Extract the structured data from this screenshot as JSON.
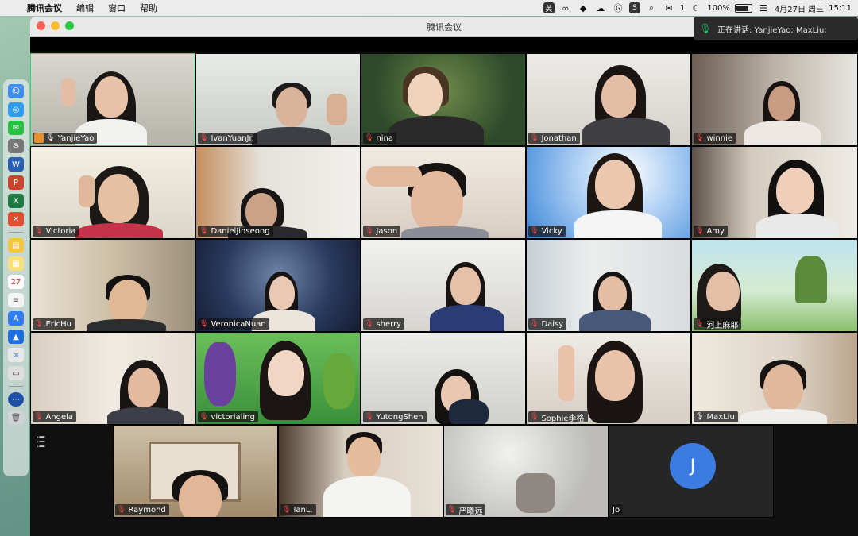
{
  "menubar": {
    "app": "腾讯会议",
    "items": [
      "编辑",
      "窗口",
      "帮助"
    ],
    "status": {
      "input_method": "英",
      "wechat_count": "1",
      "battery": "100%",
      "date": "4月27日 周三",
      "time": "15:11"
    }
  },
  "window": {
    "title": "腾讯会议",
    "speaking_label": "正在讲话: YanjieYao; MaxLiu;"
  },
  "participants": [
    {
      "name": "YanjieYao",
      "mic": "on",
      "host": true,
      "active": true
    },
    {
      "name": "IvanYuanJr.",
      "mic": "muted"
    },
    {
      "name": "nina",
      "mic": "muted"
    },
    {
      "name": "Jonathan",
      "mic": "muted"
    },
    {
      "name": "winnie",
      "mic": "muted"
    },
    {
      "name": "Victoria",
      "mic": "muted"
    },
    {
      "name": "DanielJinseong",
      "mic": "muted"
    },
    {
      "name": "Jason",
      "mic": "muted"
    },
    {
      "name": "Vicky",
      "mic": "muted"
    },
    {
      "name": "Amy",
      "mic": "muted"
    },
    {
      "name": "EricHu",
      "mic": "muted"
    },
    {
      "name": "VeronicaNuan",
      "mic": "muted"
    },
    {
      "name": "sherry",
      "mic": "muted"
    },
    {
      "name": "Daisy",
      "mic": "muted"
    },
    {
      "name": "河上麻耶",
      "mic": "muted"
    },
    {
      "name": "Angela",
      "mic": "muted"
    },
    {
      "name": "victorialing",
      "mic": "muted"
    },
    {
      "name": "YutongShen",
      "mic": "muted"
    },
    {
      "name": "Sophie李格",
      "mic": "muted"
    },
    {
      "name": "MaxLiu",
      "mic": "on"
    },
    {
      "name": "Raymond",
      "mic": "muted"
    },
    {
      "name": "IanL.",
      "mic": "muted"
    },
    {
      "name": "严曦远",
      "mic": "muted"
    },
    {
      "name": "Jo",
      "mic": "none",
      "avatar_letter": "J"
    }
  ],
  "colors": {
    "active_border": "#36d46f",
    "avatar": "#3a7ce0",
    "muted_icon": "#ff4a4a"
  }
}
